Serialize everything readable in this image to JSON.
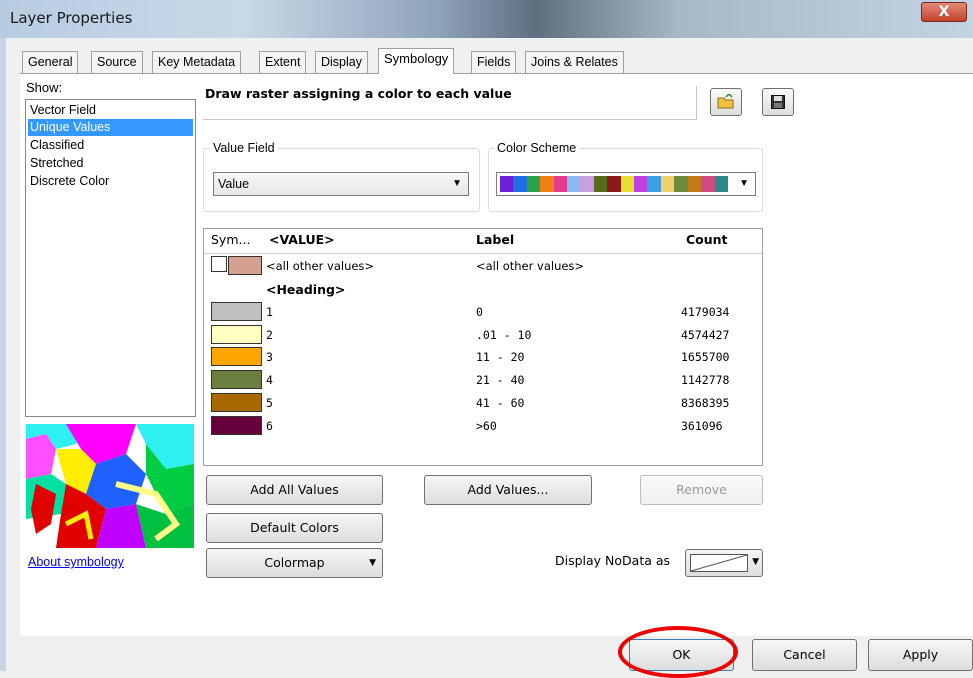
{
  "window": {
    "title": "Layer Properties",
    "close_glyph": "X"
  },
  "tabs": [
    "General",
    "Source",
    "Key Metadata",
    "Extent",
    "Display",
    "Symbology",
    "Fields",
    "Joins & Relates"
  ],
  "show": {
    "label": "Show:",
    "items": [
      "Vector Field",
      "Unique Values",
      "Classified",
      "Stretched",
      "Discrete Color"
    ],
    "selected": "Unique Values",
    "about_link": "About symbology"
  },
  "description": "Draw raster assigning a color to each value",
  "value_field": {
    "label": "Value Field",
    "selected": "Value"
  },
  "color_scheme": {
    "label": "Color Scheme",
    "colors": [
      "#6b1fd6",
      "#1f6fe0",
      "#2ea04a",
      "#f07f1a",
      "#e83a8a",
      "#8ab8f0",
      "#c8a0e0",
      "#556b1f",
      "#8b1a1a",
      "#e8e030",
      "#c040e0",
      "#3aa0e0",
      "#f0d070",
      "#6b8b3a",
      "#c07a1a",
      "#d04a80",
      "#2a8a8a"
    ]
  },
  "table": {
    "headers": {
      "symbol": "Sym...",
      "value": "<VALUE>",
      "label": "Label",
      "count": "Count"
    },
    "other": {
      "color": "#d4a090",
      "value": "<all other values>",
      "label": "<all other values>"
    },
    "heading": "<Heading>",
    "rows": [
      {
        "color": "#c0c0c0",
        "value": "1",
        "label": "0",
        "count": "4179034"
      },
      {
        "color": "#ffffc0",
        "value": "2",
        "label": ".01 - 10",
        "count": "4574427"
      },
      {
        "color": "#ffa500",
        "value": "3",
        "label": "11 - 20",
        "count": "1655700"
      },
      {
        "color": "#6b8040",
        "value": "4",
        "label": "21 - 40",
        "count": "1142778"
      },
      {
        "color": "#a86a00",
        "value": "5",
        "label": "41 - 60",
        "count": "8368395"
      },
      {
        "color": "#66003a",
        "value": "6",
        "label": ">60",
        "count": "361096"
      }
    ]
  },
  "buttons": {
    "add_all": "Add All Values",
    "add_values": "Add Values...",
    "remove": "Remove",
    "default_colors": "Default Colors",
    "colormap": "Colormap",
    "nodata_label": "Display NoData as",
    "ok": "OK",
    "cancel": "Cancel",
    "apply": "Apply"
  }
}
